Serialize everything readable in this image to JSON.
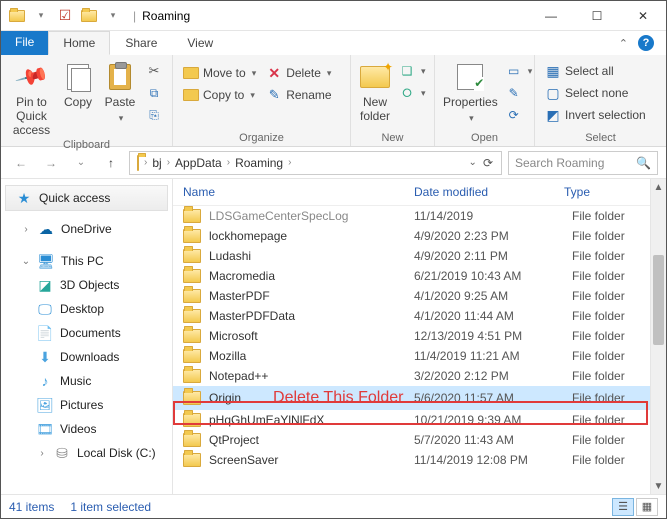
{
  "window": {
    "title": "Roaming"
  },
  "tabs": {
    "file": "File",
    "home": "Home",
    "share": "Share",
    "view": "View"
  },
  "ribbon": {
    "clipboard": {
      "label": "Clipboard",
      "pin": "Pin to Quick\naccess",
      "copy": "Copy",
      "paste": "Paste"
    },
    "organize": {
      "label": "Organize",
      "moveto": "Move to",
      "copyto": "Copy to",
      "delete": "Delete",
      "rename": "Rename"
    },
    "new": {
      "label": "New",
      "newfolder": "New\nfolder"
    },
    "open": {
      "label": "Open",
      "properties": "Properties"
    },
    "select": {
      "label": "Select",
      "selectall": "Select all",
      "selectnone": "Select none",
      "invert": "Invert selection"
    }
  },
  "breadcrumb": {
    "items": [
      "bj",
      "AppData",
      "Roaming"
    ],
    "search_placeholder": "Search Roaming"
  },
  "columns": {
    "name": "Name",
    "date": "Date modified",
    "type": "Type"
  },
  "files": [
    {
      "name": "LDSGameCenterSpecLog",
      "date": "11/14/2019",
      "type": "File folder",
      "cut": true
    },
    {
      "name": "lockhomepage",
      "date": "4/9/2020 2:23 PM",
      "type": "File folder"
    },
    {
      "name": "Ludashi",
      "date": "4/9/2020 2:11 PM",
      "type": "File folder"
    },
    {
      "name": "Macromedia",
      "date": "6/21/2019 10:43 AM",
      "type": "File folder"
    },
    {
      "name": "MasterPDF",
      "date": "4/1/2020 9:25 AM",
      "type": "File folder"
    },
    {
      "name": "MasterPDFData",
      "date": "4/1/2020 11:44 AM",
      "type": "File folder"
    },
    {
      "name": "Microsoft",
      "date": "12/13/2019 4:51 PM",
      "type": "File folder"
    },
    {
      "name": "Mozilla",
      "date": "11/4/2019 11:21 AM",
      "type": "File folder"
    },
    {
      "name": "Notepad++",
      "date": "3/2/2020 2:12 PM",
      "type": "File folder"
    },
    {
      "name": "Origin",
      "date": "5/6/2020 11:57 AM",
      "type": "File folder",
      "selected": true
    },
    {
      "name": "pHqGhUmEaYlNlFdX",
      "date": "10/21/2019 9:39 AM",
      "type": "File folder"
    },
    {
      "name": "QtProject",
      "date": "5/7/2020 11:43 AM",
      "type": "File folder"
    },
    {
      "name": "ScreenSaver",
      "date": "11/14/2019 12:08 PM",
      "type": "File folder"
    }
  ],
  "annotation": "Delete This Folder",
  "navpane": {
    "quick": "Quick access",
    "onedrive": "OneDrive",
    "thispc": "This PC",
    "sub": [
      "3D Objects",
      "Desktop",
      "Documents",
      "Downloads",
      "Music",
      "Pictures",
      "Videos",
      "Local Disk (C:)"
    ]
  },
  "status": {
    "count": "41 items",
    "selection": "1 item selected"
  }
}
